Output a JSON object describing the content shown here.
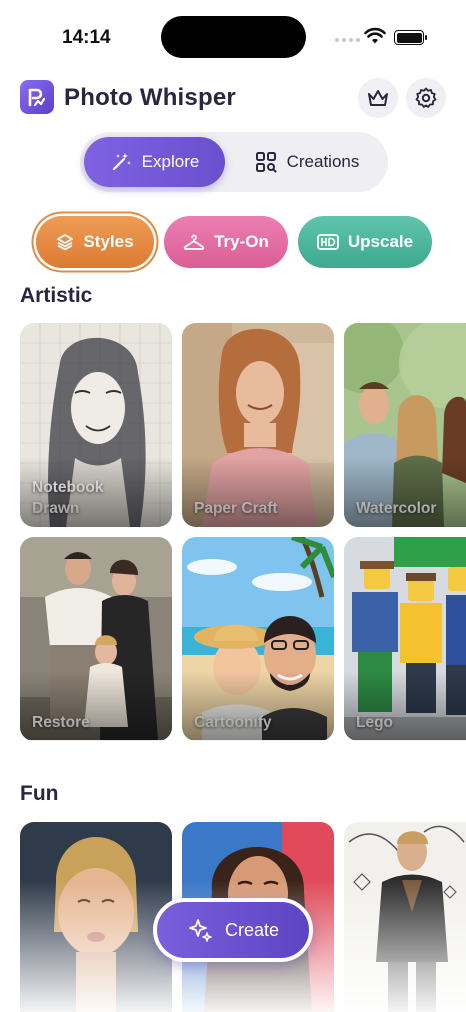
{
  "status_bar": {
    "time": "14:14"
  },
  "header": {
    "app_title": "Photo Whisper"
  },
  "segmented": {
    "explore_label": "Explore",
    "creations_label": "Creations"
  },
  "style_pills": {
    "styles": "Styles",
    "tryon": "Try-On",
    "upscale": "Upscale"
  },
  "sections": {
    "artistic": {
      "title": "Artistic",
      "cards": [
        "Notebook\nDrawn",
        "Paper Craft",
        "Watercolor",
        "Restore",
        "Cartoonify",
        "Lego"
      ]
    },
    "fun": {
      "title": "Fun"
    }
  },
  "create_button": {
    "label": "Create"
  },
  "icons": {
    "logo": "app-logo-icon",
    "crown": "crown-icon",
    "gear": "gear-icon",
    "explore": "magic-wand-icon",
    "creations": "grid-search-icon",
    "styles": "layers-icon",
    "tryon": "hanger-icon",
    "upscale": "hd-icon",
    "create": "sparkles-icon"
  },
  "colors": {
    "accent": "#6a4fcf",
    "styles_pill": "#e48a44",
    "tryon_pill": "#e16ea3",
    "upscale_pill": "#4db59b",
    "title_text": "#2b2540"
  }
}
